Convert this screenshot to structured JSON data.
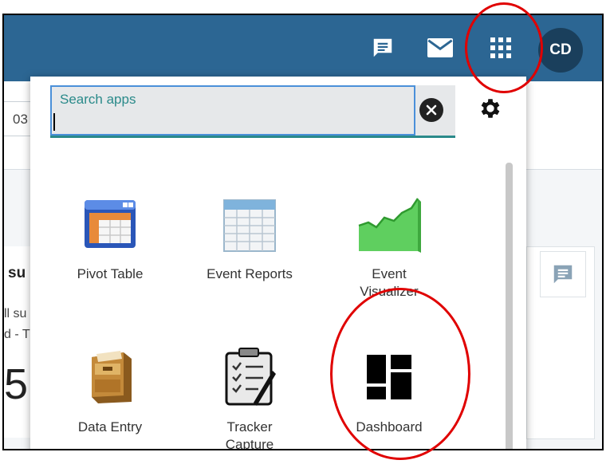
{
  "header": {
    "icons": [
      "chat-icon",
      "mail-icon",
      "apps-grid-icon"
    ],
    "avatar_initials": "CD"
  },
  "background": {
    "date_fragment": "03",
    "card_title_fragment": "su",
    "card_text_line1": "ll su",
    "card_text_line2": "d - T",
    "big_number_fragment": "5"
  },
  "app_menu": {
    "search": {
      "label": "Search apps",
      "value": ""
    },
    "apps": [
      {
        "label": "Pivot Table",
        "icon": "pivot-table-icon"
      },
      {
        "label": "Event Reports",
        "icon": "event-reports-icon"
      },
      {
        "label": "Event Visualizer",
        "icon": "event-visualizer-icon"
      },
      {
        "label": "Data Entry",
        "icon": "data-entry-icon"
      },
      {
        "label": "Tracker Capture",
        "icon": "tracker-capture-icon"
      },
      {
        "label": "Dashboard",
        "icon": "dashboard-icon"
      }
    ]
  },
  "colors": {
    "topbar": "#2c6693",
    "highlight": "#e00000",
    "accent": "#2a8a8a"
  }
}
